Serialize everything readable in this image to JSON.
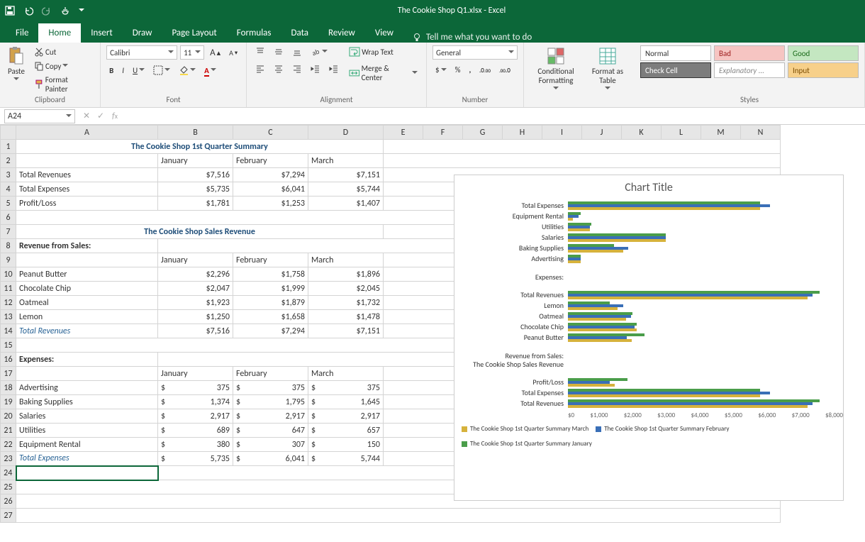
{
  "window": {
    "title": "The Cookie Shop Q1.xlsx  -  Excel"
  },
  "tabs": {
    "file": "File",
    "items": [
      "Home",
      "Insert",
      "Draw",
      "Page Layout",
      "Formulas",
      "Data",
      "Review",
      "View"
    ],
    "tellme": "Tell me what you want to do"
  },
  "ribbon": {
    "clipboard": {
      "paste": "Paste",
      "cut": "Cut",
      "copy": "Copy",
      "painter": "Format Painter",
      "label": "Clipboard"
    },
    "font": {
      "name": "Calibri",
      "size": "11",
      "label": "Font"
    },
    "alignment": {
      "wrap": "Wrap Text",
      "merge": "Merge & Center",
      "label": "Alignment"
    },
    "number": {
      "format": "General",
      "label": "Number"
    },
    "cond": {
      "label": "Conditional Formatting"
    },
    "fmtTable": {
      "label": "Format as Table"
    },
    "styles": {
      "normal": "Normal",
      "bad": "Bad",
      "good": "Good",
      "check": "Check Cell",
      "explan": "Explanatory ...",
      "input": "Input",
      "label": "Styles"
    }
  },
  "namebox": "A24",
  "columns": [
    "A",
    "B",
    "C",
    "D",
    "E",
    "F",
    "G",
    "H",
    "I",
    "J",
    "K",
    "L",
    "M",
    "N"
  ],
  "rows": {
    "title1": "The Cookie Shop 1st Quarter Summary",
    "months": {
      "jan": "January",
      "feb": "February",
      "mar": "March"
    },
    "r3": {
      "label": "Total Revenues",
      "b": "$7,516",
      "c": "$7,294",
      "d": "$7,151"
    },
    "r4": {
      "label": "Total Expenses",
      "b": "$5,735",
      "c": "$6,041",
      "d": "$5,744"
    },
    "r5": {
      "label": "Profit/Loss",
      "b": "$1,781",
      "c": "$1,253",
      "d": "$1,407"
    },
    "title2": "The Cookie Shop Sales Revenue",
    "r8": "Revenue from Sales:",
    "r10": {
      "label": "Peanut Butter",
      "b": "$2,296",
      "c": "$1,758",
      "d": "$1,896"
    },
    "r11": {
      "label": "Chocolate Chip",
      "b": "$2,047",
      "c": "$1,999",
      "d": "$2,045"
    },
    "r12": {
      "label": "Oatmeal",
      "b": "$1,923",
      "c": "$1,879",
      "d": "$1,732"
    },
    "r13": {
      "label": "Lemon",
      "b": "$1,250",
      "c": "$1,658",
      "d": "$1,478"
    },
    "r14": {
      "label": "Total Revenues",
      "b": "$7,516",
      "c": "$7,294",
      "d": "$7,151"
    },
    "r16": "Expenses:",
    "r18": {
      "label": "Advertising",
      "b": "375",
      "c": "375",
      "d": "375"
    },
    "r19": {
      "label": "Baking Supplies",
      "b": "1,374",
      "c": "1,795",
      "d": "1,645"
    },
    "r20": {
      "label": "Salaries",
      "b": "2,917",
      "c": "2,917",
      "d": "2,917"
    },
    "r21": {
      "label": "Utilities",
      "b": "689",
      "c": "647",
      "d": "657"
    },
    "r22": {
      "label": "Equipment Rental",
      "b": "380",
      "c": "307",
      "d": "150"
    },
    "r23": {
      "label": "Total Expenses",
      "b": "5,735",
      "c": "6,041",
      "d": "5,744"
    },
    "dollar": "$"
  },
  "chart": {
    "title": "Chart Title",
    "axis": [
      "$0",
      "$1,000",
      "$2,000",
      "$3,000",
      "$4,000",
      "$5,000",
      "$6,000",
      "$7,000",
      "$8,000"
    ],
    "legend": {
      "mar": "The Cookie Shop 1st Quarter Summary March",
      "feb": "The Cookie Shop 1st Quarter Summary February",
      "jan": "The Cookie Shop 1st Quarter Summary January"
    }
  },
  "chart_data": {
    "type": "bar",
    "orientation": "horizontal",
    "title": "Chart Title",
    "xlabel": "",
    "ylabel": "",
    "xlim": [
      0,
      8000
    ],
    "categories": [
      "Total Expenses",
      "Equipment Rental",
      "Utilities",
      "Salaries",
      "Baking Supplies",
      "Advertising",
      "Expenses:",
      "Total Revenues",
      "Lemon",
      "Oatmeal",
      "Chocolate Chip",
      "Peanut Butter",
      "Revenue from Sales:",
      "The Cookie Shop Sales Revenue",
      "Profit/Loss",
      "Total Expenses",
      "Total Revenues"
    ],
    "series": [
      {
        "name": "The Cookie Shop 1st Quarter Summary January",
        "color": "#4a9d4a",
        "values": [
          5735,
          380,
          689,
          2917,
          1374,
          375,
          null,
          7516,
          1250,
          1923,
          2047,
          2296,
          null,
          null,
          1781,
          5735,
          7516
        ]
      },
      {
        "name": "The Cookie Shop 1st Quarter Summary February",
        "color": "#3a6fb7",
        "values": [
          6041,
          307,
          647,
          2917,
          1795,
          375,
          null,
          7294,
          1658,
          1879,
          1999,
          1758,
          null,
          null,
          1253,
          6041,
          7294
        ]
      },
      {
        "name": "The Cookie Shop 1st Quarter Summary March",
        "color": "#d6b23c",
        "values": [
          5744,
          150,
          657,
          2917,
          1645,
          375,
          null,
          7151,
          1478,
          1732,
          2045,
          1896,
          null,
          null,
          1407,
          5744,
          7151
        ]
      }
    ]
  }
}
